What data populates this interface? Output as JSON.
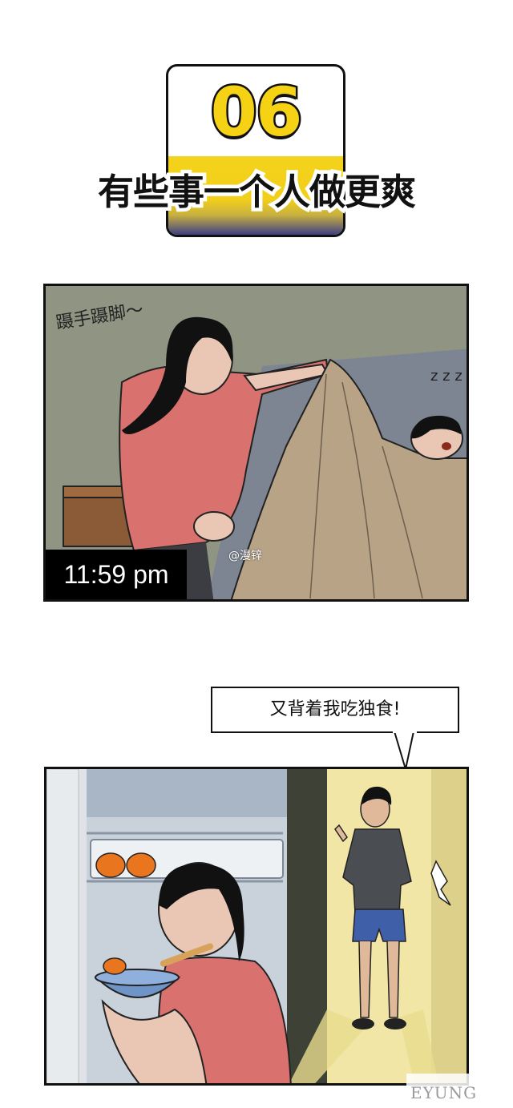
{
  "badge": {
    "number": "06"
  },
  "subtitle": "有些事一个人做更爽",
  "panel1": {
    "sfx": "蹑手蹑脚～",
    "snore": "z z z",
    "time": "11:59 pm",
    "watermark": "@漫锌",
    "colors": {
      "wall": "#8f9483",
      "shirt": "#d9716e",
      "blanket": "#b8a386",
      "sofa": "#7d8592"
    }
  },
  "bubble": {
    "text": "又背着我吃独食!"
  },
  "panel2": {
    "colors": {
      "fridge": "#dfe3e8",
      "doorway": "#f1e6a6",
      "shirt_dark": "#4a4d52",
      "shorts": "#3f5fa8",
      "bowl": "#6f95c8",
      "orange": "#e9761f"
    }
  },
  "logo": {
    "text": "EYUNG"
  }
}
